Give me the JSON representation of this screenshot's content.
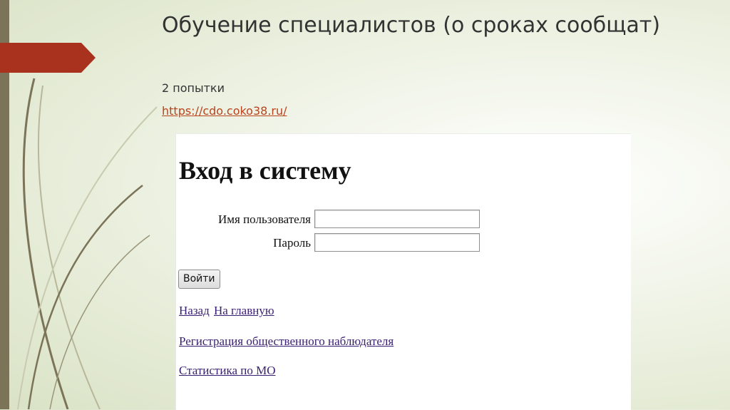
{
  "slide": {
    "title": "Обучение специалистов (о сроках сообщат)",
    "subtitle": "2 попытки",
    "link": "https://cdo.coko38.ru/"
  },
  "login_form": {
    "heading": "Вход в систему",
    "username_label": "Имя пользователя",
    "username_value": "",
    "password_label": "Пароль",
    "password_value": "",
    "submit_label": "Войти",
    "back_link": "Назад",
    "home_link": "На главную",
    "register_link": "Регистрация общественного наблюдателя",
    "stats_link": "Статистика по МО"
  },
  "colors": {
    "accent": "#a8321e",
    "sidebar": "#7b7458",
    "link": "#b8441e"
  }
}
